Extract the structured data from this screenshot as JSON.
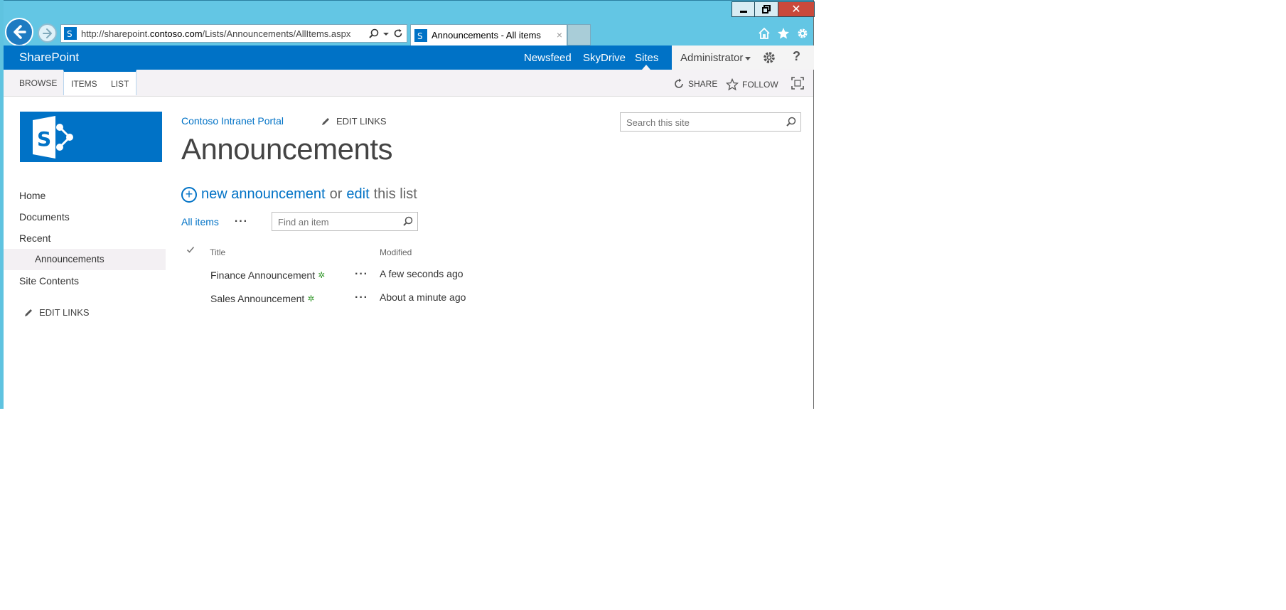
{
  "browser": {
    "address": {
      "prefix": "http://sharepoint.",
      "host": "contoso.com",
      "path": "/Lists/Announcements/AllItems.aspx"
    },
    "tab_title": "Announcements - All items",
    "tab_close": "×",
    "close_glyph": "✕"
  },
  "suitebar": {
    "brand": "SharePoint",
    "links": {
      "newsfeed": "Newsfeed",
      "skydrive": "SkyDrive",
      "sites": "Sites"
    },
    "user": "Administrator",
    "help": "?"
  },
  "ribbon": {
    "tabs": {
      "browse": "BROWSE",
      "items": "ITEMS",
      "list": "LIST"
    },
    "share": "SHARE",
    "follow": "FOLLOW"
  },
  "quicklaunch": {
    "items": [
      "Home",
      "Documents",
      "Recent",
      "Announcements",
      "Site Contents"
    ],
    "edit_links": "EDIT LINKS"
  },
  "main": {
    "breadcrumb": "Contoso Intranet Portal",
    "edit_links": "EDIT LINKS",
    "title": "Announcements",
    "search_placeholder": "Search this site",
    "new_announcement": "new announcement",
    "or": "or",
    "edit": "edit",
    "this_list": "this list",
    "view_all_items": "All items",
    "view_ellipsis": "···",
    "find_placeholder": "Find an item",
    "columns": {
      "title": "Title",
      "modified": "Modified"
    },
    "rows": [
      {
        "title": "Finance Announcement",
        "modified": "A few seconds ago"
      },
      {
        "title": "Sales Announcement",
        "modified": "About a minute ago"
      }
    ],
    "row_ellipsis": "···",
    "new_badge": "✲"
  },
  "colors": {
    "accent": "#0072c6",
    "titlebar": "#63c6e4",
    "close": "#c9493b"
  }
}
